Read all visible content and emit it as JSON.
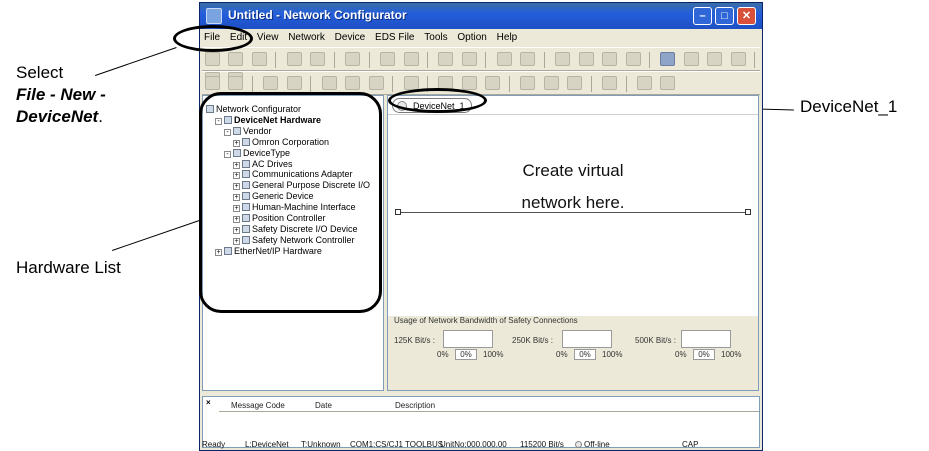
{
  "window": {
    "title": "Untitled - Network Configurator",
    "buttons": {
      "minimize": "–",
      "maximize": "□",
      "close": "✕"
    }
  },
  "menu": [
    "File",
    "Edit",
    "View",
    "Network",
    "Device",
    "EDS File",
    "Tools",
    "Option",
    "Help"
  ],
  "hardware_tree": [
    {
      "label": "Network Configurator",
      "indent": 0,
      "bold": false,
      "expander": ""
    },
    {
      "label": "DeviceNet Hardware",
      "indent": 1,
      "bold": true,
      "expander": "-"
    },
    {
      "label": "Vendor",
      "indent": 2,
      "bold": false,
      "expander": "-"
    },
    {
      "label": "Omron Corporation",
      "indent": 3,
      "bold": false,
      "expander": "+"
    },
    {
      "label": "DeviceType",
      "indent": 2,
      "bold": false,
      "expander": "-"
    },
    {
      "label": "AC Drives",
      "indent": 3,
      "bold": false,
      "expander": "+"
    },
    {
      "label": "Communications Adapter",
      "indent": 3,
      "bold": false,
      "expander": "+"
    },
    {
      "label": "General Purpose Discrete I/O",
      "indent": 3,
      "bold": false,
      "expander": "+"
    },
    {
      "label": "Generic Device",
      "indent": 3,
      "bold": false,
      "expander": "+"
    },
    {
      "label": "Human-Machine Interface",
      "indent": 3,
      "bold": false,
      "expander": "+"
    },
    {
      "label": "Position Controller",
      "indent": 3,
      "bold": false,
      "expander": "+"
    },
    {
      "label": "Safety Discrete I/O Device",
      "indent": 3,
      "bold": false,
      "expander": "+"
    },
    {
      "label": "Safety Network Controller",
      "indent": 3,
      "bold": false,
      "expander": "+"
    },
    {
      "label": "EtherNet/IP Hardware",
      "indent": 1,
      "bold": false,
      "expander": "+"
    }
  ],
  "network": {
    "tab_label": "DeviceNet_1",
    "hint_line1": "Create virtual",
    "hint_line2": "network here."
  },
  "bandwidth": {
    "title": "Usage of Network Bandwidth of Safety Connections",
    "rates": [
      "125K Bit/s :",
      "250K Bit/s :",
      "500K Bit/s :"
    ],
    "zero": "0%",
    "current": "0%",
    "hundred": "100%"
  },
  "messages": {
    "close": "×",
    "columns": [
      "Message Code",
      "Date",
      "Description"
    ]
  },
  "status": {
    "ready": "Ready",
    "network": "L:DeviceNet",
    "target": "T:Unknown",
    "port": "COM1:CS/CJ1 TOOLBUS",
    "unit": "UnitNo:000.000.00",
    "baud": "115200 Bit/s",
    "mode": "Off-line",
    "caps": "CAP"
  },
  "callouts": {
    "select_line1": "Select",
    "select_line2": "File - New -",
    "select_line3": "DeviceNet",
    "select_period": ".",
    "devicenet": "DeviceNet_1",
    "hardware_list": "Hardware List"
  }
}
